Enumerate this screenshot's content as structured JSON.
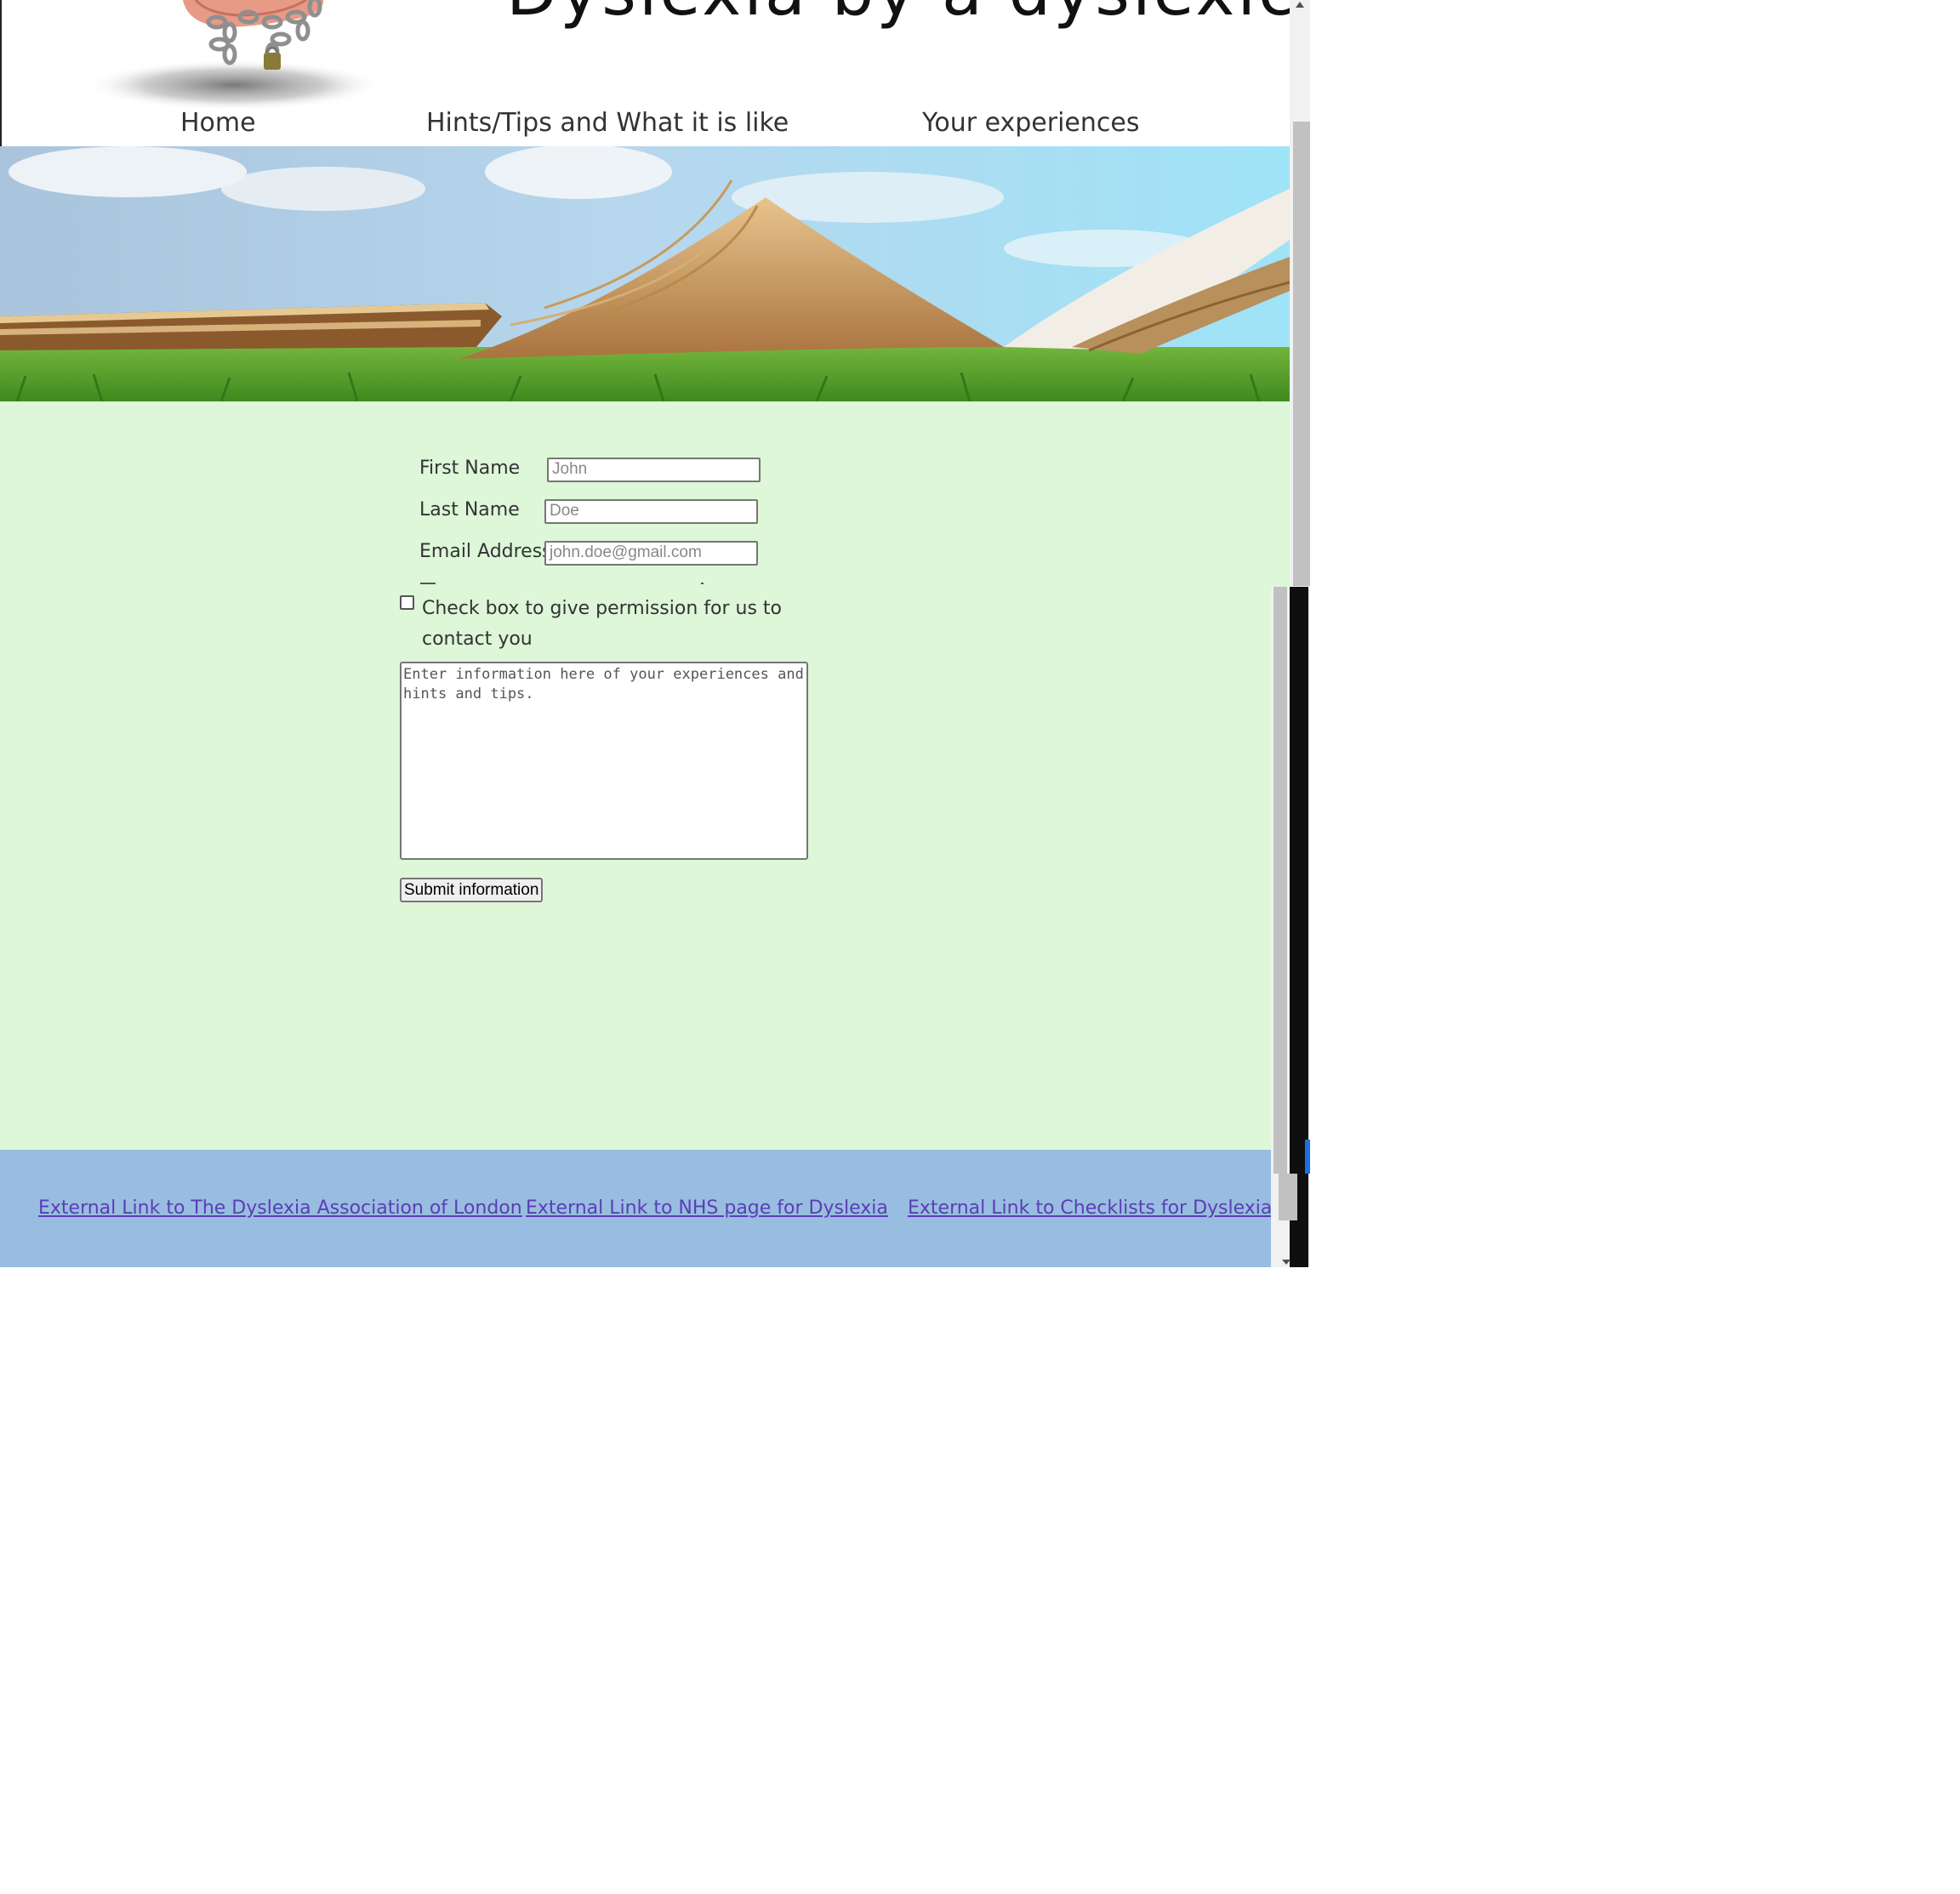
{
  "header": {
    "site_title": "Dyslexia by a dyslexic",
    "logo_icon": "chained-brain-logo"
  },
  "nav": {
    "items": [
      {
        "label": "Home"
      },
      {
        "label": "Hints/Tips and What it is like"
      },
      {
        "label": "Your experiences"
      }
    ]
  },
  "hero": {
    "image": "open-book-on-grass-banner"
  },
  "form": {
    "first_name": {
      "label": "First Name",
      "placeholder": "John"
    },
    "last_name": {
      "label": "Last Name",
      "placeholder": "Doe"
    },
    "email": {
      "label": "Email Address",
      "placeholder": "john.doe@gmail.com"
    },
    "permission_label": "Check box to give permission for us to contact you",
    "permission_checked": false,
    "experience_placeholder": "Enter information here of your experiences and hints and tips.",
    "submit_label": "Submit information"
  },
  "footer": {
    "links": [
      {
        "label": "External Link to The Dyslexia Association of London"
      },
      {
        "label": "External Link to NHS page for Dyslexia"
      },
      {
        "label": "External Link to Checklists for Dyslexia"
      }
    ]
  },
  "colors": {
    "content_background": "#ddf7d8",
    "footer_background": "#98bde0",
    "link_color": "#5b3db5"
  }
}
